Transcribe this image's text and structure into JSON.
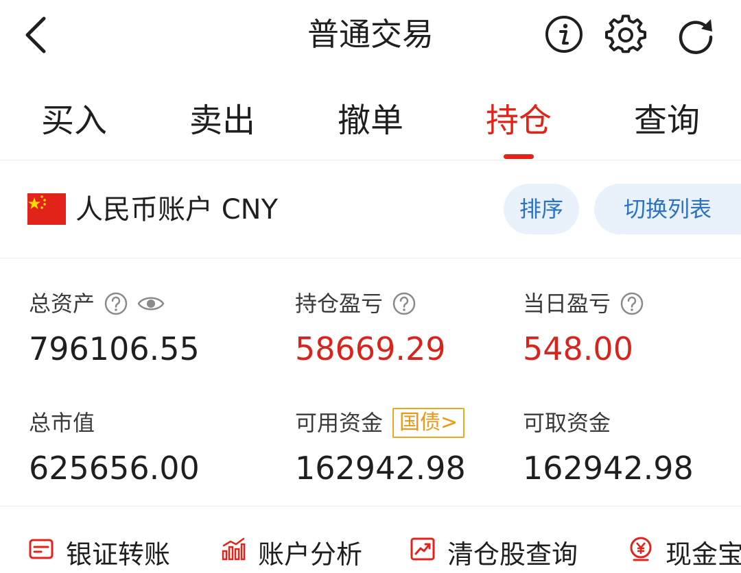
{
  "header": {
    "title": "普通交易",
    "back_icon": "chevron-left-icon",
    "info_icon": "info-icon",
    "settings_icon": "gear-icon",
    "refresh_icon": "refresh-icon"
  },
  "tabs": [
    {
      "label": "买入",
      "active": false
    },
    {
      "label": "卖出",
      "active": false
    },
    {
      "label": "撤单",
      "active": false
    },
    {
      "label": "持仓",
      "active": true
    },
    {
      "label": "查询",
      "active": false
    }
  ],
  "account": {
    "flag_icon": "china-flag-icon",
    "label": "人民币账户 CNY",
    "sort_button": "排序",
    "switch_button": "切换列表"
  },
  "stats": {
    "total_assets": {
      "label": "总资产",
      "value": "796106.55"
    },
    "position_pnl": {
      "label": "持仓盈亏",
      "value": "58669.29"
    },
    "daily_pnl": {
      "label": "当日盈亏",
      "value": "548.00"
    },
    "market_value": {
      "label": "总市值",
      "value": "625656.00"
    },
    "available_funds": {
      "label": "可用资金",
      "value": "162942.98",
      "badge": "国债",
      "badge_arrow": ">"
    },
    "withdrawable_funds": {
      "label": "可取资金",
      "value": "162942.98"
    }
  },
  "toolbar": [
    {
      "label": "银证转账",
      "icon": "card-icon"
    },
    {
      "label": "账户分析",
      "icon": "bar-chart-icon"
    },
    {
      "label": "清仓股查询",
      "icon": "trend-chart-icon"
    },
    {
      "label": "现金宝",
      "icon": "yuan-coin-icon"
    }
  ],
  "colors": {
    "accent_red": "#e2231a",
    "profit_red": "#d9231d",
    "pill_bg": "#e9f1fb",
    "pill_text": "#2a72c8",
    "badge_orange": "#f19612"
  }
}
